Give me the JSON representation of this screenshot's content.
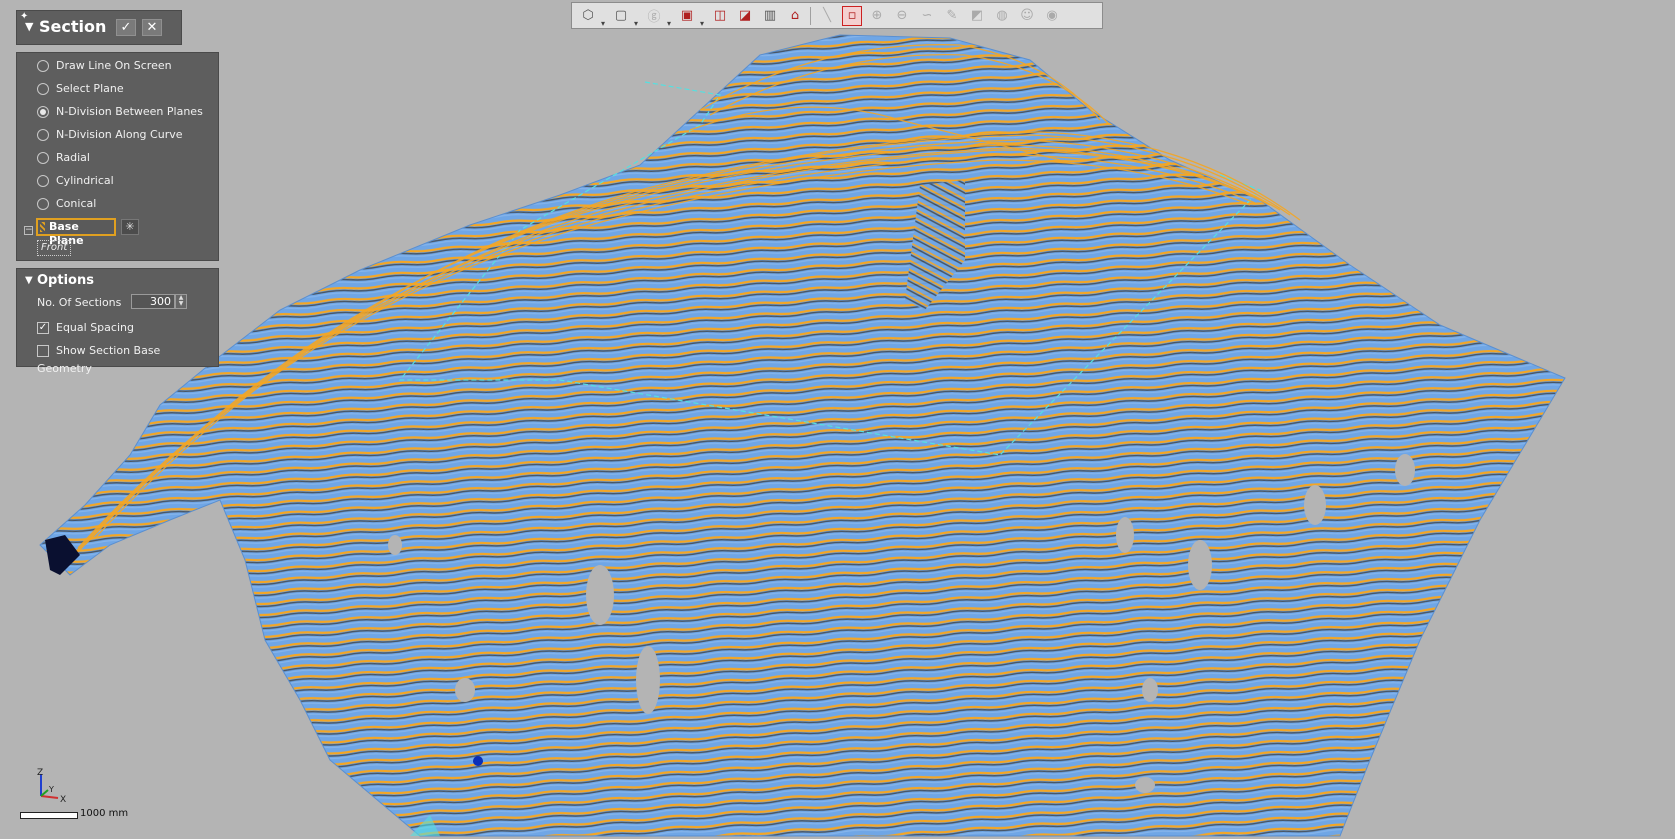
{
  "section": {
    "title": "Section",
    "methods": [
      {
        "label": "Draw Line On Screen",
        "selected": false
      },
      {
        "label": "Select Plane",
        "selected": false
      },
      {
        "label": "N-Division Between Planes",
        "selected": true
      },
      {
        "label": "N-Division Along Curve",
        "selected": false
      },
      {
        "label": "Radial",
        "selected": false
      },
      {
        "label": "Cylindrical",
        "selected": false
      },
      {
        "label": "Conical",
        "selected": false
      }
    ],
    "base_plane_label": "Base Plane",
    "base_plane_item": "Front"
  },
  "options": {
    "title": "Options",
    "num_sections_label": "No. Of Sections",
    "num_sections_value": "300",
    "equal_spacing_label": "Equal Spacing",
    "equal_spacing_checked": true,
    "show_base_geometry_label": "Show Section Base Geometry",
    "show_base_geometry_checked": false
  },
  "toolbar": {
    "icons": [
      "polygon-select-icon",
      "box-select-icon",
      "lasso-select-icon",
      "cube-view-icon",
      "plane-front-icon",
      "plane-side-icon",
      "split-view-icon",
      "section-view-icon",
      "line-measure-icon",
      "rect-select-icon",
      "add-point-icon",
      "remove-point-icon",
      "free-curve-icon",
      "brush-select-icon",
      "surface-select-icon",
      "sphere-select-icon",
      "person-select-icon",
      "visibility-icon"
    ]
  },
  "axes": {
    "z": "Z",
    "y": "Y",
    "x": "X"
  },
  "scale": {
    "label": "1000 mm"
  },
  "colors": {
    "background": "#b4b4b4",
    "mesh": "#6fa6e6",
    "section_lines": "#f5a623",
    "plane_outline": "#55e0e0",
    "panel": "#5e5e5e",
    "highlight": "#e0a020"
  }
}
